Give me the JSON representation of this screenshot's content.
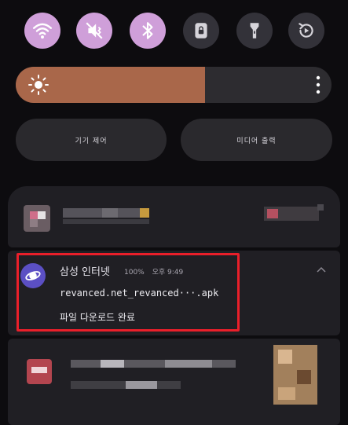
{
  "quick_settings": [
    {
      "id": "wifi",
      "icon": "wifi-icon",
      "state": "on"
    },
    {
      "id": "sound",
      "icon": "vibrate-mute-icon",
      "state": "on"
    },
    {
      "id": "bluetooth",
      "icon": "bluetooth-icon",
      "state": "on"
    },
    {
      "id": "lock",
      "icon": "lock-icon",
      "state": "off"
    },
    {
      "id": "flashlight",
      "icon": "flashlight-icon",
      "state": "off"
    },
    {
      "id": "rotate",
      "icon": "auto-rotate-icon",
      "state": "off"
    }
  ],
  "brightness": {
    "level": 0.6
  },
  "controls": {
    "device_control": "기기 제어",
    "media_output": "미디어 출력"
  },
  "notification": {
    "app_name": "삼성 인터넷",
    "progress": "100%",
    "time": "오후 9:49",
    "title": "revanced.net_revanced···.apk",
    "body": "파일 다운로드 완료"
  },
  "colors": {
    "toggle_on": "#cf9fd9",
    "toggle_off": "#333239",
    "brightness_fill": "#a9674a",
    "app_icon": "#5b4fc4",
    "highlight": "#ea1f2a"
  }
}
